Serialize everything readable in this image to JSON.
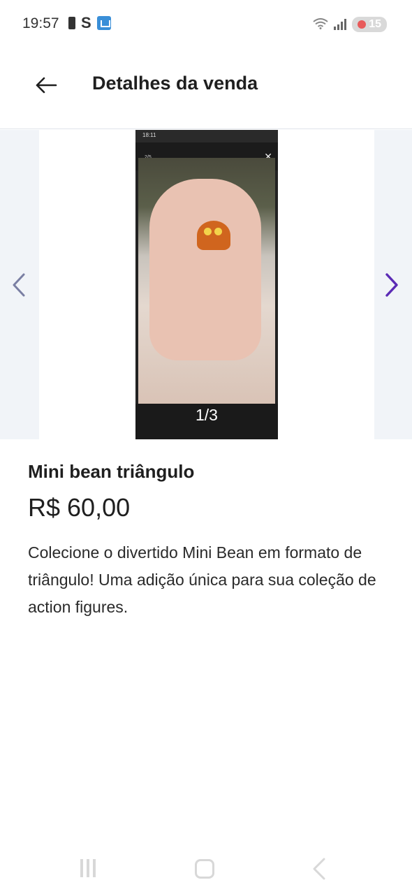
{
  "status_bar": {
    "time": "19:57",
    "s_label": "S",
    "battery_level": "15",
    "icons": [
      "battery-icon",
      "home-app-icon",
      "wifi-icon",
      "signal-icon"
    ]
  },
  "header": {
    "title": "Detalhes da venda",
    "back_icon": "arrow-left-icon"
  },
  "gallery": {
    "counter": "1/3",
    "inner_counter": "2/5",
    "inner_time": "18:11",
    "prev_icon": "chevron-left-icon",
    "next_icon": "chevron-right-icon"
  },
  "product": {
    "name": "Mini bean triângulo",
    "price": "R$ 60,00",
    "description": "Colecione o divertido Mini Bean em formato de triângulo! Uma adição única para sua coleção de action figures."
  },
  "colors": {
    "accent": "#5b2bb5",
    "prev_arrow": "#7a7fa3",
    "divider": "#dfe3ea",
    "gallery_side": "#f1f4f8"
  },
  "nav_bar": {
    "icons": [
      "recent-apps-icon",
      "home-icon",
      "back-icon"
    ]
  }
}
